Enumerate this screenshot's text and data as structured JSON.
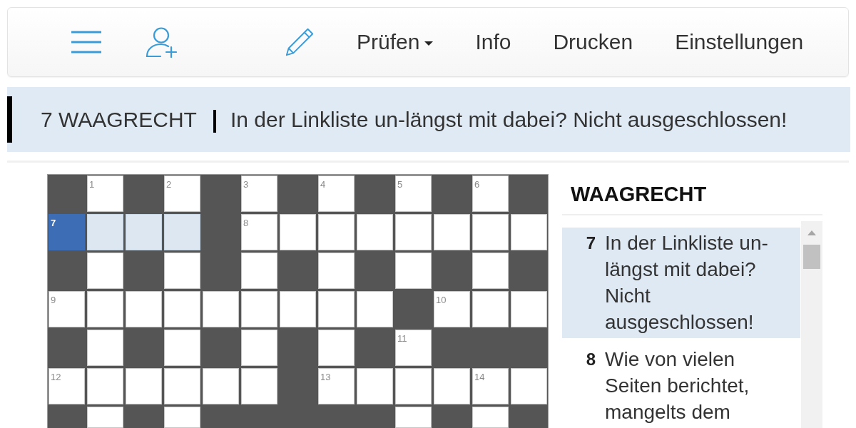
{
  "toolbar": {
    "menu_items": [
      {
        "label": "Prüfen",
        "kind": "dropdown"
      },
      {
        "label": "Info",
        "kind": "link"
      },
      {
        "label": "Drucken",
        "kind": "link"
      },
      {
        "label": "Einstellungen",
        "kind": "link"
      }
    ]
  },
  "current_clue": {
    "label": "7 WAAGRECHT",
    "text": "In der Linkliste un-längst mit dabei? Nicht ausgeschlossen!"
  },
  "grid": {
    "rows": [
      [
        {
          "kind": "block"
        },
        {
          "kind": "letter",
          "number": "1",
          "selected": false,
          "highlighted": false
        },
        {
          "kind": "block"
        },
        {
          "kind": "letter",
          "number": "2",
          "selected": false,
          "highlighted": false
        },
        {
          "kind": "block"
        },
        {
          "kind": "letter",
          "number": "3",
          "selected": false,
          "highlighted": false
        },
        {
          "kind": "block"
        },
        {
          "kind": "letter",
          "number": "4",
          "selected": false,
          "highlighted": false
        },
        {
          "kind": "block"
        },
        {
          "kind": "letter",
          "number": "5",
          "selected": false,
          "highlighted": false
        },
        {
          "kind": "block"
        },
        {
          "kind": "letter",
          "number": "6",
          "selected": false,
          "highlighted": false
        },
        {
          "kind": "block"
        }
      ],
      [
        {
          "kind": "letter",
          "number": "7",
          "selected": true,
          "highlighted": false
        },
        {
          "kind": "letter",
          "selected": false,
          "highlighted": true
        },
        {
          "kind": "letter",
          "selected": false,
          "highlighted": true
        },
        {
          "kind": "letter",
          "selected": false,
          "highlighted": true
        },
        {
          "kind": "block"
        },
        {
          "kind": "letter",
          "number": "8",
          "selected": false,
          "highlighted": false
        },
        {
          "kind": "letter",
          "selected": false,
          "highlighted": false
        },
        {
          "kind": "letter",
          "selected": false,
          "highlighted": false
        },
        {
          "kind": "letter",
          "selected": false,
          "highlighted": false
        },
        {
          "kind": "letter",
          "selected": false,
          "highlighted": false
        },
        {
          "kind": "letter",
          "selected": false,
          "highlighted": false
        },
        {
          "kind": "letter",
          "selected": false,
          "highlighted": false
        },
        {
          "kind": "letter",
          "selected": false,
          "highlighted": false
        }
      ],
      [
        {
          "kind": "block"
        },
        {
          "kind": "letter",
          "selected": false,
          "highlighted": false
        },
        {
          "kind": "block"
        },
        {
          "kind": "letter",
          "selected": false,
          "highlighted": false
        },
        {
          "kind": "block"
        },
        {
          "kind": "letter",
          "selected": false,
          "highlighted": false
        },
        {
          "kind": "block"
        },
        {
          "kind": "letter",
          "selected": false,
          "highlighted": false
        },
        {
          "kind": "block"
        },
        {
          "kind": "letter",
          "selected": false,
          "highlighted": false
        },
        {
          "kind": "block"
        },
        {
          "kind": "letter",
          "selected": false,
          "highlighted": false
        },
        {
          "kind": "block"
        }
      ],
      [
        {
          "kind": "letter",
          "number": "9",
          "selected": false,
          "highlighted": false
        },
        {
          "kind": "letter",
          "selected": false,
          "highlighted": false
        },
        {
          "kind": "letter",
          "selected": false,
          "highlighted": false
        },
        {
          "kind": "letter",
          "selected": false,
          "highlighted": false
        },
        {
          "kind": "letter",
          "selected": false,
          "highlighted": false
        },
        {
          "kind": "letter",
          "selected": false,
          "highlighted": false
        },
        {
          "kind": "letter",
          "selected": false,
          "highlighted": false
        },
        {
          "kind": "letter",
          "selected": false,
          "highlighted": false
        },
        {
          "kind": "letter",
          "selected": false,
          "highlighted": false
        },
        {
          "kind": "block"
        },
        {
          "kind": "letter",
          "number": "10",
          "selected": false,
          "highlighted": false
        },
        {
          "kind": "letter",
          "selected": false,
          "highlighted": false
        },
        {
          "kind": "letter",
          "selected": false,
          "highlighted": false
        }
      ],
      [
        {
          "kind": "block"
        },
        {
          "kind": "letter",
          "selected": false,
          "highlighted": false
        },
        {
          "kind": "block"
        },
        {
          "kind": "letter",
          "selected": false,
          "highlighted": false
        },
        {
          "kind": "block"
        },
        {
          "kind": "letter",
          "selected": false,
          "highlighted": false
        },
        {
          "kind": "block"
        },
        {
          "kind": "letter",
          "selected": false,
          "highlighted": false
        },
        {
          "kind": "block"
        },
        {
          "kind": "letter",
          "number": "11",
          "selected": false,
          "highlighted": false
        },
        {
          "kind": "block"
        },
        {
          "kind": "block"
        },
        {
          "kind": "block"
        }
      ],
      [
        {
          "kind": "letter",
          "number": "12",
          "selected": false,
          "highlighted": false
        },
        {
          "kind": "letter",
          "selected": false,
          "highlighted": false
        },
        {
          "kind": "letter",
          "selected": false,
          "highlighted": false
        },
        {
          "kind": "letter",
          "selected": false,
          "highlighted": false
        },
        {
          "kind": "letter",
          "selected": false,
          "highlighted": false
        },
        {
          "kind": "letter",
          "selected": false,
          "highlighted": false
        },
        {
          "kind": "block"
        },
        {
          "kind": "letter",
          "number": "13",
          "selected": false,
          "highlighted": false
        },
        {
          "kind": "letter",
          "selected": false,
          "highlighted": false
        },
        {
          "kind": "letter",
          "selected": false,
          "highlighted": false
        },
        {
          "kind": "letter",
          "selected": false,
          "highlighted": false
        },
        {
          "kind": "letter",
          "number": "14",
          "selected": false,
          "highlighted": false
        },
        {
          "kind": "letter",
          "selected": false,
          "highlighted": false
        }
      ],
      [
        {
          "kind": "block"
        },
        {
          "kind": "letter",
          "selected": false,
          "highlighted": false
        },
        {
          "kind": "block"
        },
        {
          "kind": "letter",
          "selected": false,
          "highlighted": false
        },
        {
          "kind": "block"
        },
        {
          "kind": "block"
        },
        {
          "kind": "block"
        },
        {
          "kind": "block"
        },
        {
          "kind": "block"
        },
        {
          "kind": "letter",
          "selected": false,
          "highlighted": false
        },
        {
          "kind": "block"
        },
        {
          "kind": "letter",
          "selected": false,
          "highlighted": false
        },
        {
          "kind": "block"
        }
      ]
    ]
  },
  "clue_list": {
    "heading": "WAAGRECHT",
    "clues": [
      {
        "number": "7",
        "text": "In der Linkliste un-längst mit dabei? Nicht ausgeschlossen!",
        "selected": true
      },
      {
        "number": "8",
        "text": "Wie von vielen Seiten berichtet, mangelts dem",
        "selected": false
      }
    ]
  }
}
